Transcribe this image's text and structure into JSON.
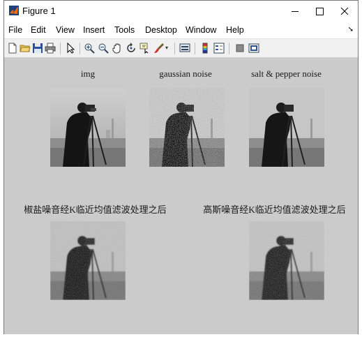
{
  "window": {
    "title": "Figure 1",
    "controls": [
      "minimize-icon",
      "maximize-icon",
      "close-icon"
    ]
  },
  "menubar": {
    "items": [
      "File",
      "Edit",
      "View",
      "Insert",
      "Tools",
      "Desktop",
      "Window",
      "Help"
    ]
  },
  "toolbar": {
    "buttons": [
      "new-figure-icon",
      "open-icon",
      "save-icon",
      "print-icon",
      "pointer-icon",
      "zoom-in-icon",
      "zoom-out-icon",
      "pan-icon",
      "rotate-icon",
      "data-cursor-icon",
      "brush-icon",
      "link-icon",
      "colorbar-icon",
      "legend-icon",
      "hide-plot-tools-icon",
      "show-plot-tools-icon"
    ]
  },
  "axes": {
    "top": [
      {
        "title": "img"
      },
      {
        "title": "gaussian noise"
      },
      {
        "title": "salt & pepper noise"
      }
    ],
    "bottom": [
      {
        "title": "椒盐噪音经K临近均值滤波处理之后"
      },
      {
        "title": "高斯噪音经K临近均值滤波处理之后"
      }
    ]
  },
  "colors": {
    "figure_background": "#cbcbcb",
    "toolbar_background": "#f0f0f0"
  }
}
